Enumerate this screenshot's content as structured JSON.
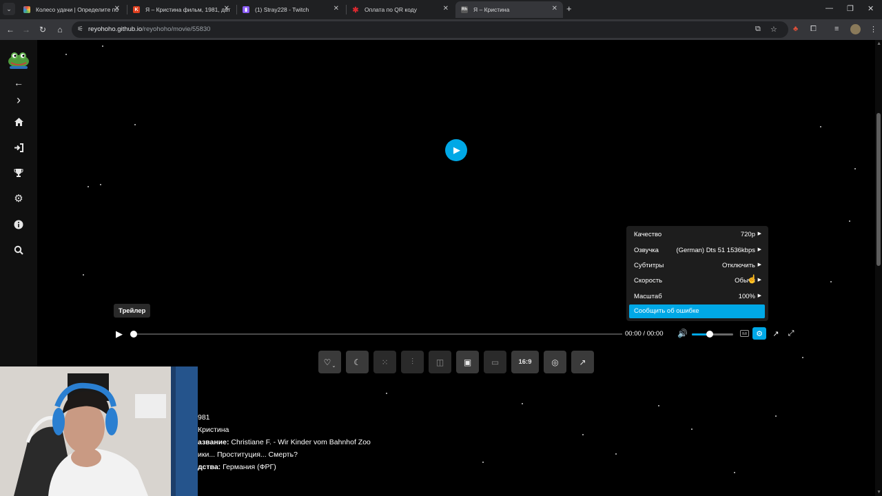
{
  "browser": {
    "tabs": [
      {
        "title": "Колесо удачи | Определите по",
        "favicon": "wheel-icon",
        "color": "#d9a441",
        "active": false
      },
      {
        "title": "Я – Кристина фильм, 1981, дат",
        "favicon": "kp-icon",
        "color": "#e0401f",
        "active": false
      },
      {
        "title": "(1) Stray228 - Twitch",
        "favicon": "twitch-icon",
        "color": "#8a5cf5",
        "active": false
      },
      {
        "title": "Оплата по QR коду",
        "favicon": "star-icon",
        "color": "#d8292f",
        "active": false
      },
      {
        "title": "Я – Кристина",
        "favicon": "rh-icon",
        "color": "#5a5a5a",
        "active": true
      }
    ],
    "url": {
      "host": "reyohoho.github.io",
      "path": "/reyohoho/movie/55830"
    }
  },
  "colors": {
    "accent": "#00a8e6",
    "background": "#000000",
    "menu_bg": "#1e1e1e"
  },
  "sidebar": {
    "items": [
      {
        "name": "back-arrow-icon",
        "glyph": "←"
      },
      {
        "name": "forward-chevron-icon",
        "glyph": "›"
      },
      {
        "name": "home-icon",
        "glyph": "⌂"
      },
      {
        "name": "login-icon",
        "glyph": "⇥"
      },
      {
        "name": "trophy-icon",
        "glyph": "🏆"
      },
      {
        "name": "gear-icon",
        "glyph": "⚙"
      },
      {
        "name": "info-icon",
        "glyph": "ℹ"
      },
      {
        "name": "search-icon",
        "glyph": "⌕"
      }
    ]
  },
  "player": {
    "tooltip": "Трейлер",
    "time_current": "00:00",
    "time_separator": "/",
    "time_total": "00:00",
    "volume_level": 0.45,
    "progress_level": 0.0,
    "settings_menu": {
      "rows": [
        {
          "label": "Качество",
          "value": "720p"
        },
        {
          "label": "Озвучка",
          "value": "(German) Dts 51 1536kbps"
        },
        {
          "label": "Субтитры",
          "value": "Отключить"
        },
        {
          "label": "Скорость",
          "value": "Обычн"
        },
        {
          "label": "Масштаб",
          "value": "100%"
        }
      ],
      "report_label": "Сообщить об ошибке"
    }
  },
  "toolbar": {
    "buttons": [
      {
        "name": "favorite-heart-button",
        "glyph": "♡"
      },
      {
        "name": "night-mode-button",
        "glyph": "☾"
      },
      {
        "name": "grid-button",
        "glyph": "⁙"
      },
      {
        "name": "audio-wave-button",
        "glyph": "⫶"
      },
      {
        "name": "compare-button",
        "glyph": "◫"
      },
      {
        "name": "image-button",
        "glyph": "▣"
      },
      {
        "name": "pip-button",
        "glyph": "▭"
      },
      {
        "name": "aspect-ratio-button",
        "glyph": "16:9"
      },
      {
        "name": "screenshot-button",
        "glyph": "◎"
      },
      {
        "name": "open-external-button",
        "glyph": "↗"
      }
    ]
  },
  "movie_info": {
    "year": "981",
    "title": "Кристина",
    "original_label": "азвание:",
    "original_value": " Christiane F. - Wir Kinder vom Bahnhof Zoo",
    "tagline": "ики... Проституция... Смерть?",
    "country_label": "дства:",
    "country_value": " Германия (ФРГ)"
  }
}
